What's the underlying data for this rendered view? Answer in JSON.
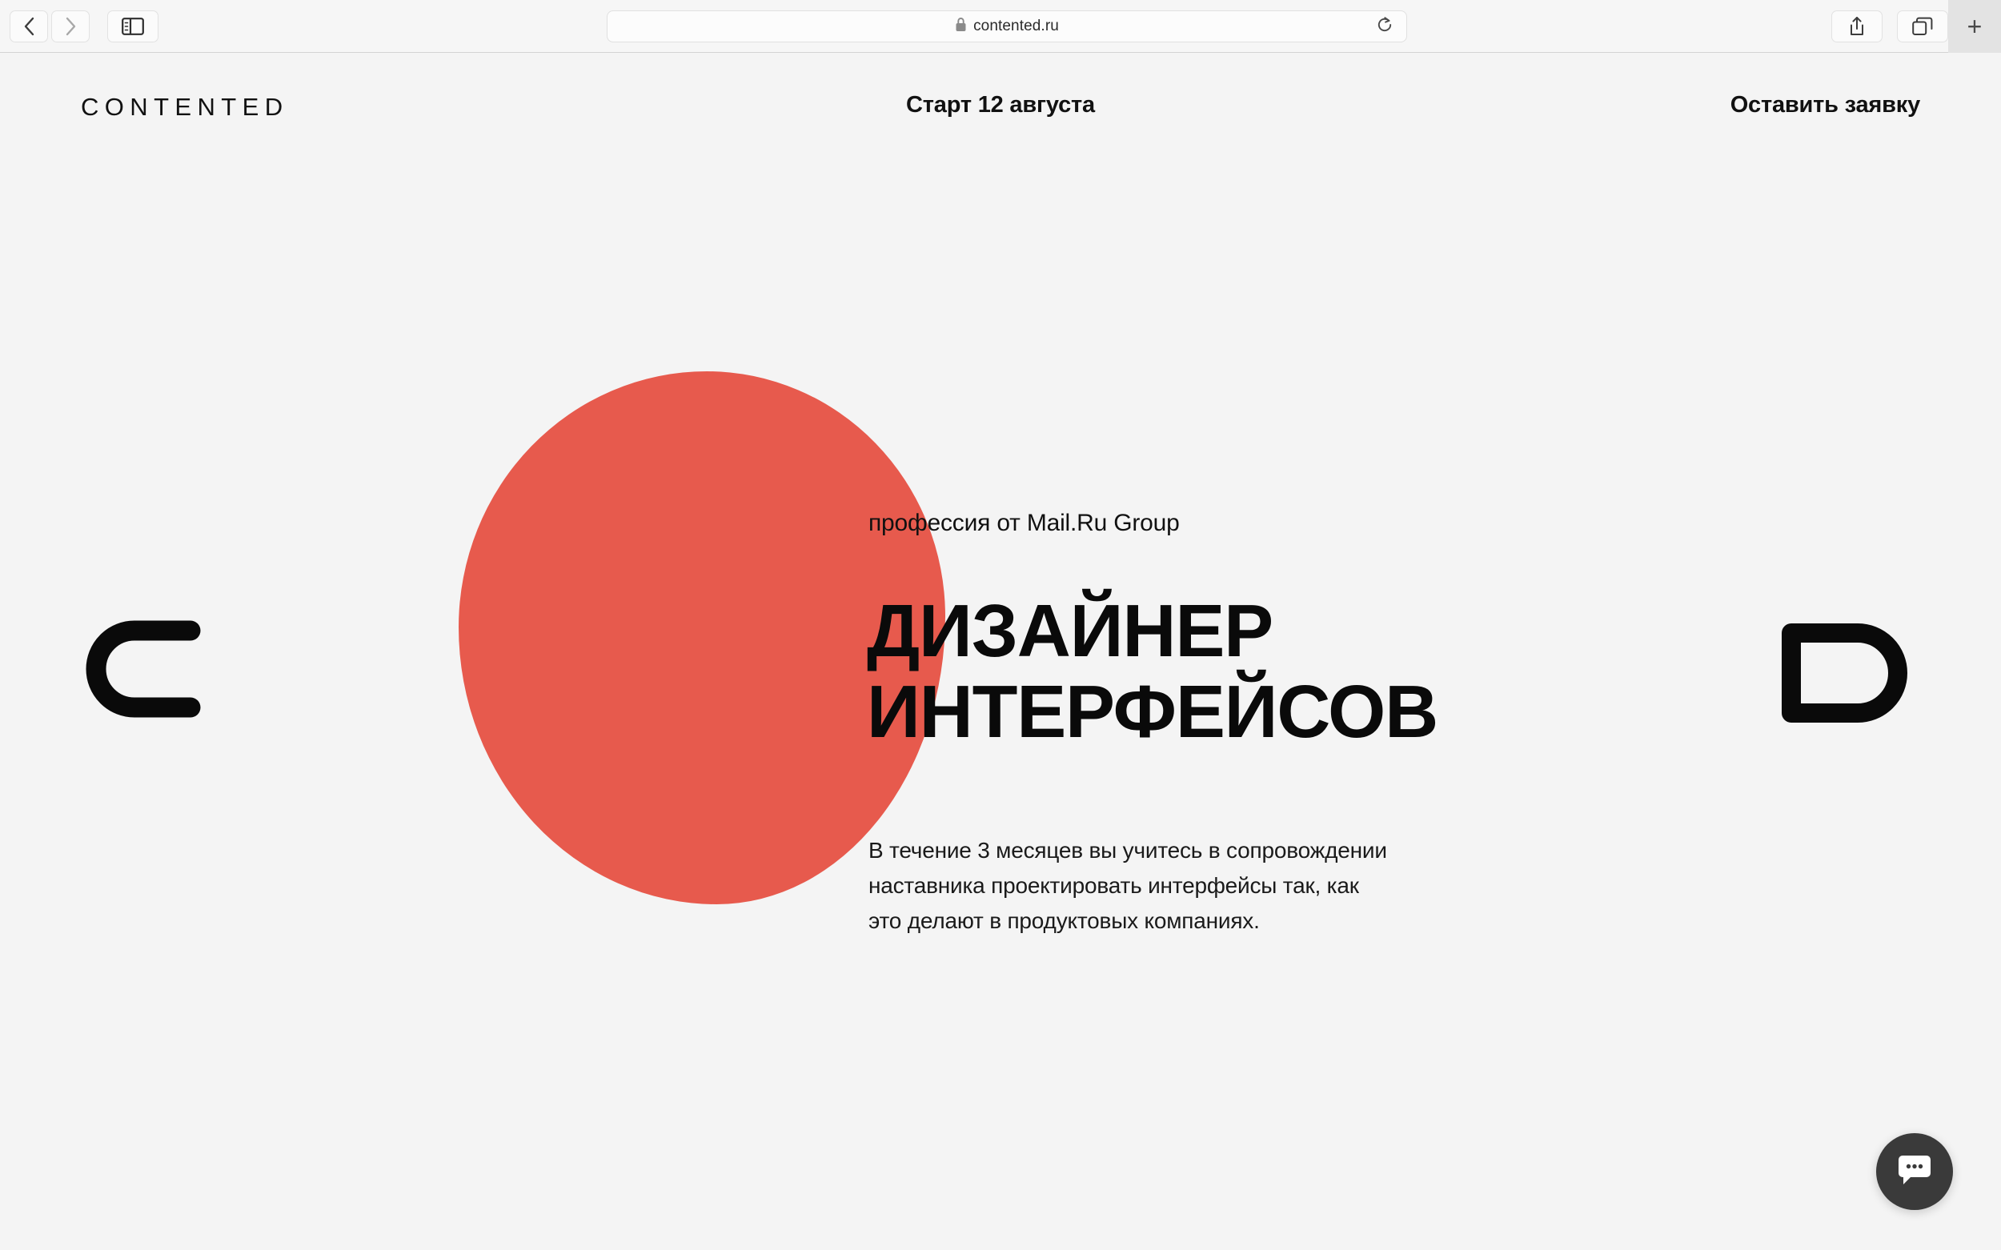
{
  "browser": {
    "back_icon": "chevron-left-icon",
    "forward_icon": "chevron-right-icon",
    "sidebar_icon": "sidebar-toggle-icon",
    "lock_icon": "lock-icon",
    "url": "contented.ru",
    "reload_icon": "reload-icon",
    "share_icon": "share-icon",
    "tabs_icon": "tab-overview-icon",
    "new_tab_label": "+"
  },
  "header": {
    "logo": "CONTENTED",
    "start_date": "Старт 12 августа",
    "cta": "Оставить заявку"
  },
  "decor": {
    "left_letter": "C",
    "right_letter": "D",
    "blob_color": "#e75a4d"
  },
  "hero": {
    "eyebrow": "профессия от Mail.Ru Group",
    "title_line1": "ДИЗАЙНЕР",
    "title_line2": "ИНТЕРФЕЙСОВ",
    "desc_line1": "В течение 3 месяцев вы учитесь в сопровождении",
    "desc_line2": "наставника проектировать интерфейсы так, как",
    "desc_line3": "это делают в продуктовых компаниях."
  },
  "chat": {
    "icon": "chat-bubble-icon"
  }
}
